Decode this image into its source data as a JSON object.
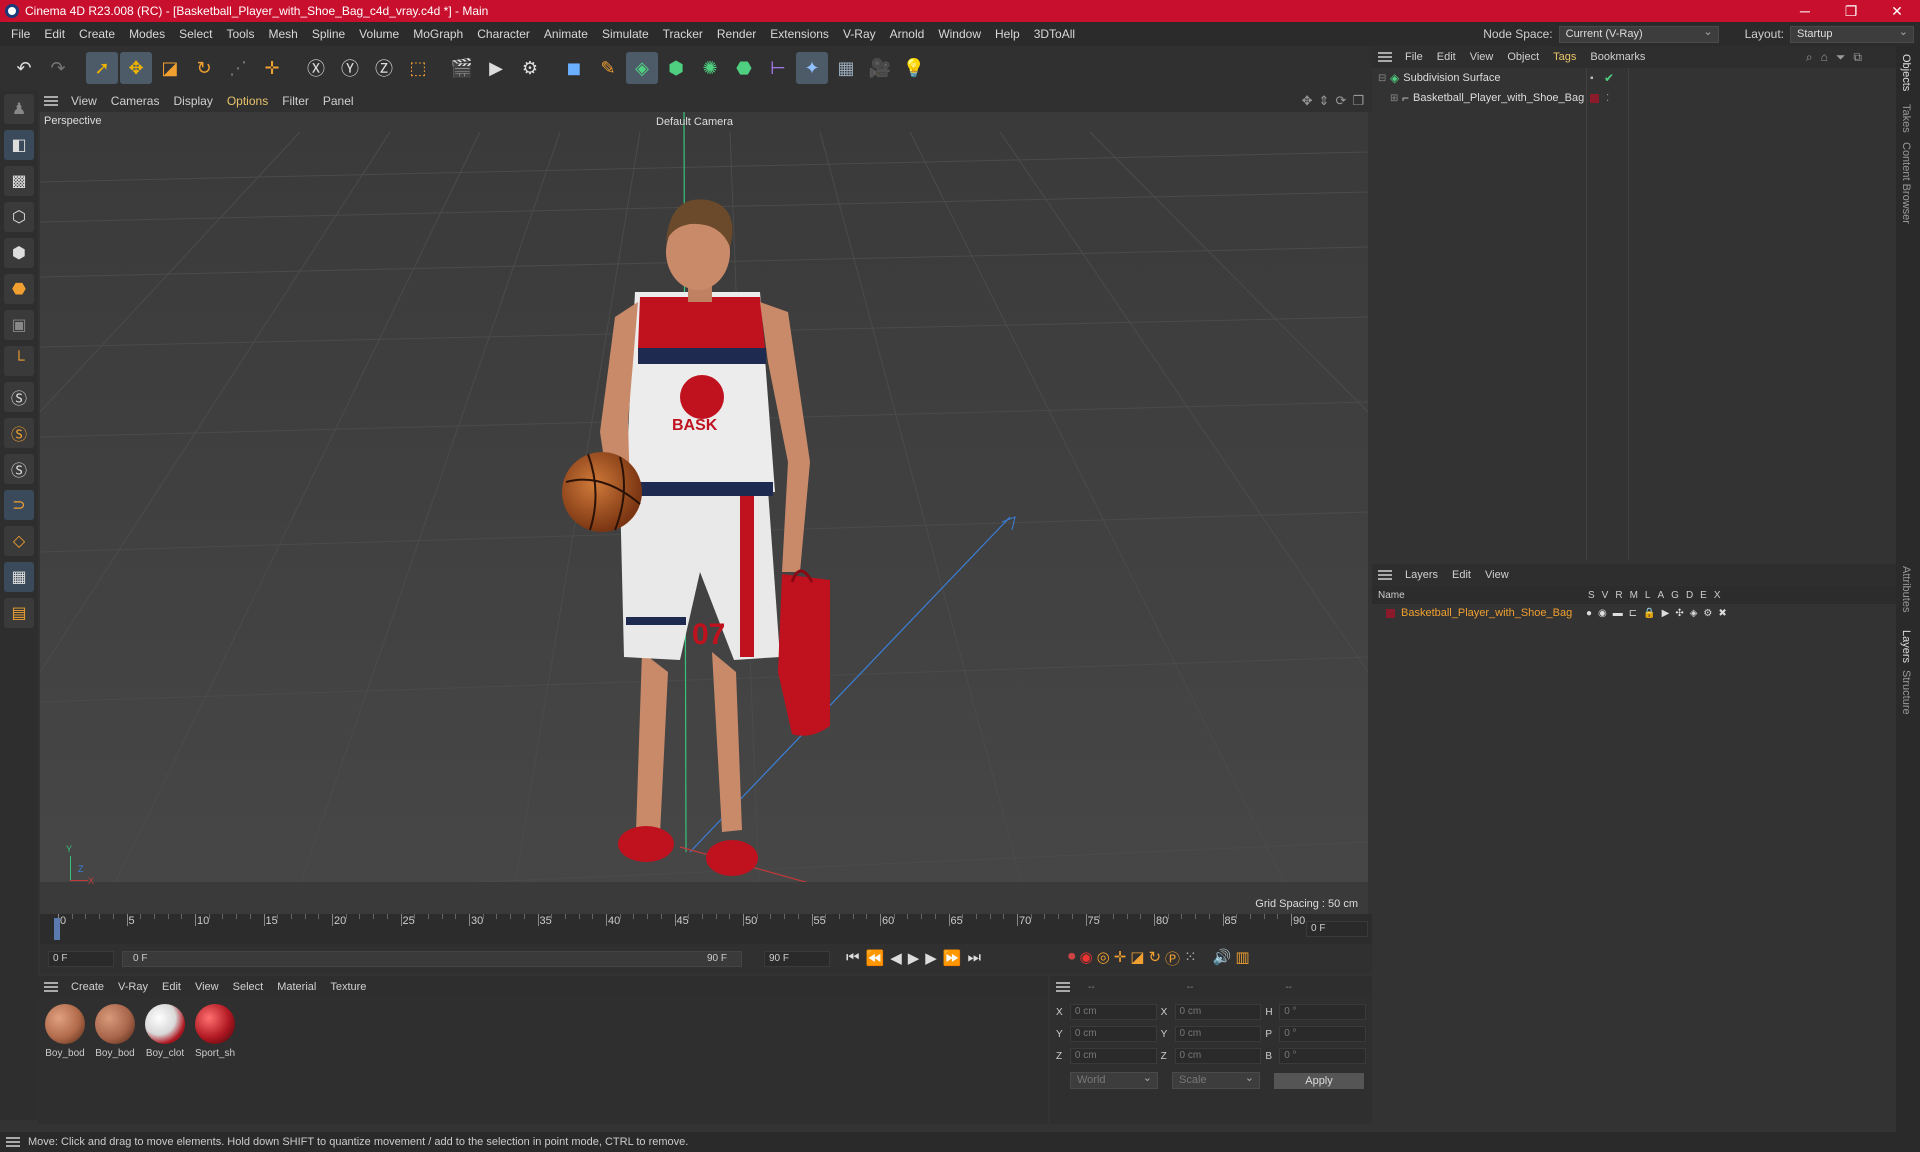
{
  "titlebar": {
    "title": "Cinema 4D R23.008 (RC) - [Basketball_Player_with_Shoe_Bag_c4d_vray.c4d *] - Main",
    "minimize": "─",
    "restore": "❐",
    "close": "✕"
  },
  "menubar": {
    "items": [
      "File",
      "Edit",
      "Create",
      "Modes",
      "Select",
      "Tools",
      "Mesh",
      "Spline",
      "Volume",
      "MoGraph",
      "Character",
      "Animate",
      "Simulate",
      "Tracker",
      "Render",
      "Extensions",
      "V-Ray",
      "Arnold",
      "Window",
      "Help",
      "3DToAll"
    ],
    "node_space_label": "Node Space:",
    "node_space_value": "Current (V-Ray)",
    "layout_label": "Layout:",
    "layout_value": "Startup"
  },
  "viewport": {
    "menu": [
      "View",
      "Cameras",
      "Display",
      "Options",
      "Filter",
      "Panel"
    ],
    "name": "Perspective",
    "camera": "Default Camera",
    "grid_spacing": "Grid Spacing : 50 cm",
    "axis_y": "Y",
    "axis_z": "Z",
    "axis_x": "X"
  },
  "timeline": {
    "ticks": [
      "0",
      "5",
      "10",
      "15",
      "20",
      "25",
      "30",
      "35",
      "40",
      "45",
      "50",
      "55",
      "60",
      "65",
      "70",
      "75",
      "80",
      "85",
      "90"
    ],
    "current_frame_right": "0 F",
    "start_field": "0 F",
    "range_start": "0 F",
    "range_end": "90 F",
    "end_field": "90 F"
  },
  "materials": {
    "menu": [
      "Create",
      "V-Ray",
      "Edit",
      "View",
      "Select",
      "Material",
      "Texture"
    ],
    "items": [
      {
        "label": "Boy_bod",
        "color": "#b06a4a"
      },
      {
        "label": "Boy_bod",
        "color": "#a8654a"
      },
      {
        "label": "Boy_clot",
        "color": "#d8d8d8"
      },
      {
        "label": "Sport_sh",
        "color": "#b01822"
      }
    ]
  },
  "coords": {
    "headers": [
      "--",
      "--",
      "--"
    ],
    "rows": [
      {
        "a_label": "X",
        "a_val": "0 cm",
        "b_label": "X",
        "b_val": "0 cm",
        "c_label": "H",
        "c_val": "0 °"
      },
      {
        "a_label": "Y",
        "a_val": "0 cm",
        "b_label": "Y",
        "b_val": "0 cm",
        "c_label": "P",
        "c_val": "0 °"
      },
      {
        "a_label": "Z",
        "a_val": "0 cm",
        "b_label": "Z",
        "b_val": "0 cm",
        "c_label": "B",
        "c_val": "0 °"
      }
    ],
    "world": "World",
    "scale": "Scale",
    "apply": "Apply"
  },
  "objects": {
    "menu": [
      "File",
      "Edit",
      "View",
      "Object",
      "Tags",
      "Bookmarks"
    ],
    "items": [
      {
        "name": "Subdivision Surface"
      },
      {
        "name": "Basketball_Player_with_Shoe_Bag"
      }
    ]
  },
  "layers": {
    "menu": [
      "Layers",
      "Edit",
      "View"
    ],
    "col_name": "Name",
    "cols": [
      "S",
      "V",
      "R",
      "M",
      "L",
      "A",
      "G",
      "D",
      "E",
      "X"
    ],
    "row_name": "Basketball_Player_with_Shoe_Bag",
    "layer_color": "#8b1a2a"
  },
  "right_tabs": [
    "Objects",
    "Takes",
    "Content Browser",
    "Attributes",
    "Layers",
    "Structure"
  ],
  "status": "Move: Click and drag to move elements. Hold down SHIFT to quantize movement / add to the selection in point mode, CTRL to remove.",
  "colors": {
    "accent": "#e8c36a",
    "title": "#c8102e",
    "selection": "#4d5a68"
  }
}
